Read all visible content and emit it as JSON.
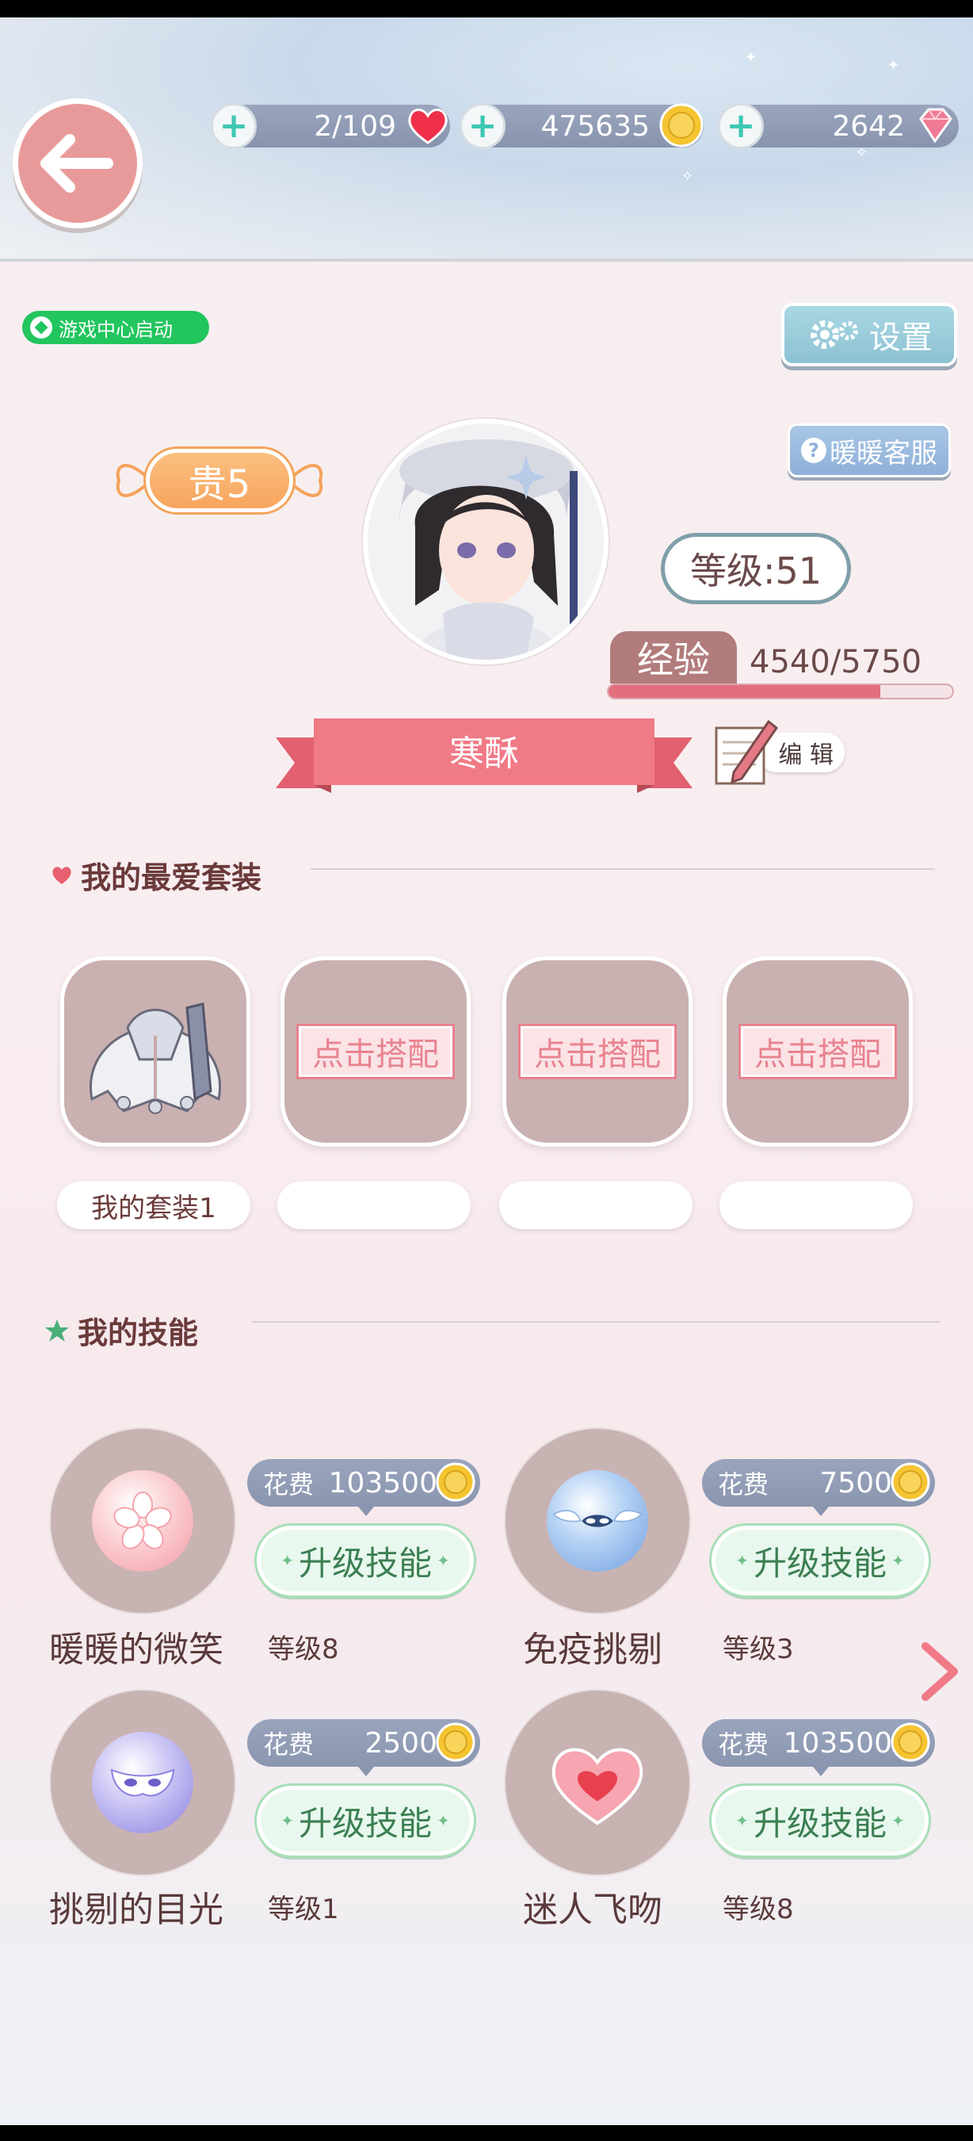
{
  "header": {
    "resources": {
      "stamina": "2/109",
      "coins": "475635",
      "diamonds": "2642"
    }
  },
  "game_center_label": "游戏中心启动",
  "settings_label": "设置",
  "service_label": "暖暖客服",
  "profile": {
    "vip": "贵5",
    "level": "等级:51",
    "exp_label": "经验",
    "exp_value": "4540/5750",
    "exp_progress": 0.79,
    "name": "寒酥",
    "edit_label": "编 辑"
  },
  "outfits": {
    "title": "我的最爱套装",
    "slots": [
      {
        "name": "我的套装1",
        "label": ""
      },
      {
        "name": "",
        "label": "点击搭配"
      },
      {
        "name": "",
        "label": "点击搭配"
      },
      {
        "name": "",
        "label": "点击搭配"
      }
    ]
  },
  "skills": {
    "title": "我的技能",
    "items": [
      {
        "name": "暖暖的微笑",
        "level": "等级8",
        "cost_label": "花费",
        "cost": "103500",
        "button": "升级技能"
      },
      {
        "name": "免疫挑剔",
        "level": "等级3",
        "cost_label": "花费",
        "cost": "7500",
        "button": "升级技能"
      },
      {
        "name": "挑剔的目光",
        "level": "等级1",
        "cost_label": "花费",
        "cost": "2500",
        "button": "升级技能"
      },
      {
        "name": "迷人飞吻",
        "level": "等级8",
        "cost_label": "花费",
        "cost": "103500",
        "button": "升级技能"
      }
    ]
  },
  "colors": {
    "accent_pink": "#e36e7e",
    "vip_orange": "#f7a55e",
    "upgrade_green": "#a7dfb8"
  },
  "icons": [
    "back-arrow-icon",
    "plus-icon",
    "heart-icon",
    "coin-icon",
    "diamond-icon",
    "gear-icon",
    "question-icon",
    "pencil-icon",
    "star-icon",
    "chevron-right-icon"
  ]
}
